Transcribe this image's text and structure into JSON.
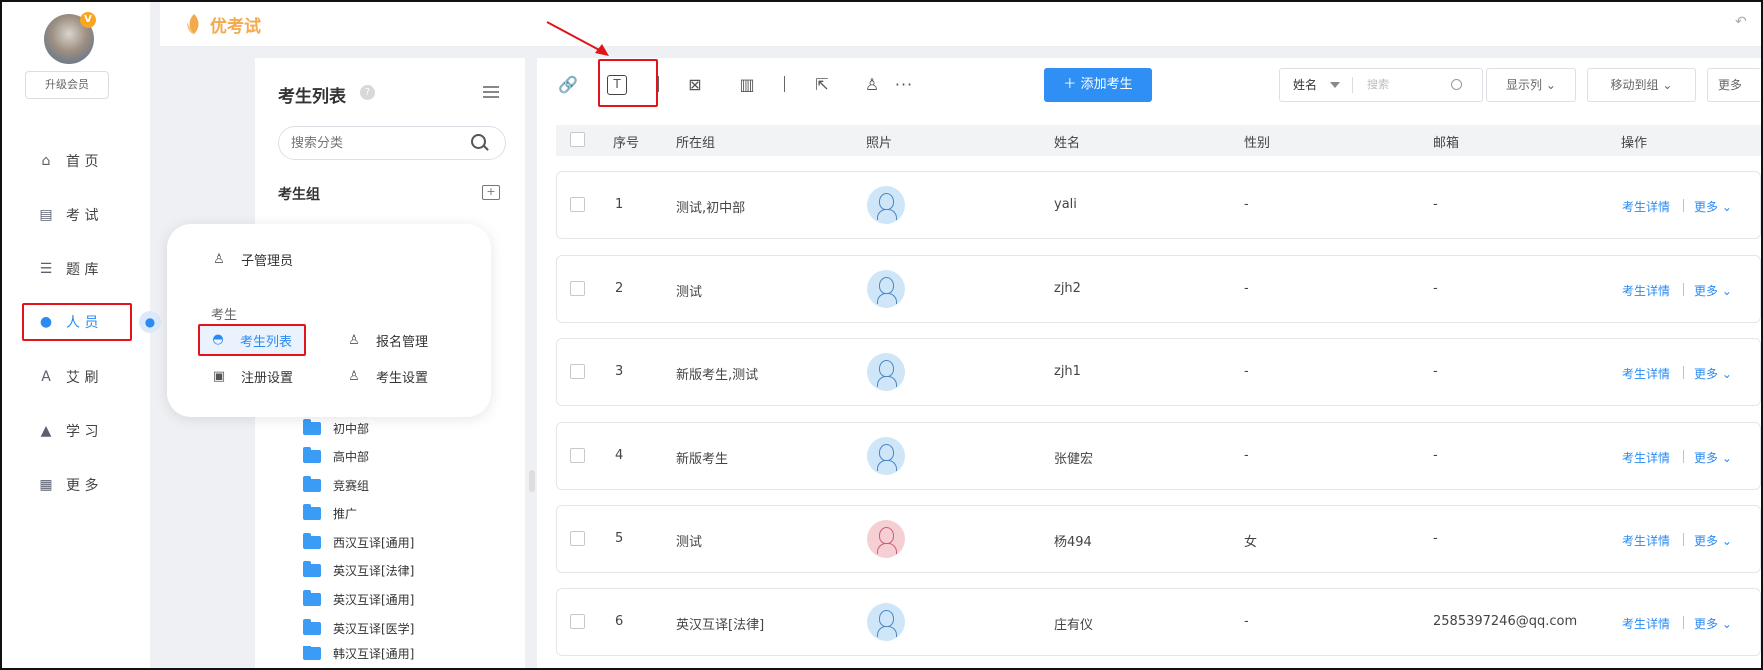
{
  "app": {
    "logo_text": "优考试",
    "upgrade_label": "升级会员",
    "avatar_badge": "V"
  },
  "nav": {
    "items": [
      {
        "label": "首 页",
        "icon": "home-icon"
      },
      {
        "label": "考 试",
        "icon": "exam-icon"
      },
      {
        "label": "题 库",
        "icon": "question-bank-icon"
      },
      {
        "label": "人 员",
        "icon": "person-icon",
        "active": true
      },
      {
        "label": "艾 刷",
        "icon": "practice-icon"
      },
      {
        "label": "学 习",
        "icon": "study-icon"
      },
      {
        "label": "更 多",
        "icon": "more-grid-icon"
      }
    ]
  },
  "flyout": {
    "sub_admin": "子管理员",
    "section_label": "考生",
    "student_list": "考生列表",
    "registration_mgmt": "报名管理",
    "register_settings": "注册设置",
    "student_settings": "考生设置"
  },
  "category": {
    "title": "考生列表",
    "search_placeholder": "搜索分类",
    "group_label": "考生组",
    "folders": [
      "初中部",
      "高中部",
      "竞赛组",
      "推广",
      "西汉互译[通用]",
      "英汉互译[法律]",
      "英汉互译[通用]",
      "英汉互译[医学]",
      "韩汉互译[通用]"
    ]
  },
  "toolbar": {
    "add_label": "添加考生",
    "filter_field": "姓名",
    "filter_placeholder": "搜索",
    "columns_label": "显示列",
    "move_label": "移动到组",
    "more_label": "更多"
  },
  "table": {
    "headers": {
      "index": "序号",
      "group": "所在组",
      "photo": "照片",
      "name": "姓名",
      "gender": "性别",
      "email": "邮箱",
      "actions": "操作"
    },
    "detail_label": "考生详情",
    "more_label": "更多",
    "rows": [
      {
        "index": "1",
        "group": "测试,初中部",
        "name": "yali",
        "gender": "-",
        "email": "-",
        "photo": "male"
      },
      {
        "index": "2",
        "group": "测试",
        "name": "zjh2",
        "gender": "-",
        "email": "-",
        "photo": "male"
      },
      {
        "index": "3",
        "group": "新版考生,测试",
        "name": "zjh1",
        "gender": "-",
        "email": "-",
        "photo": "male"
      },
      {
        "index": "4",
        "group": "新版考生",
        "name": "张健宏",
        "gender": "-",
        "email": "-",
        "photo": "male"
      },
      {
        "index": "5",
        "group": "测试",
        "name": "杨494",
        "gender": "女",
        "email": "-",
        "photo": "female"
      },
      {
        "index": "6",
        "group": "英汉互译[法律]",
        "name": "庄有仪",
        "gender": "-",
        "email": "2585397246@qq.com",
        "photo": "male"
      }
    ]
  },
  "colors": {
    "accent": "#2a8bf2",
    "highlight": "#e0141a",
    "brand": "#f5a94d"
  }
}
